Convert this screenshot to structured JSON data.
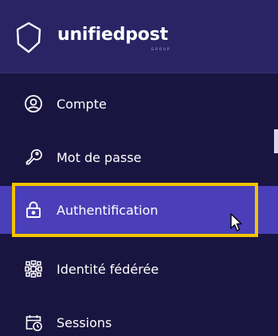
{
  "brand": {
    "name": "unifiedpost",
    "sub": "GROUP"
  },
  "menu": {
    "items": [
      {
        "label": "Compte",
        "icon": "user-circle-icon"
      },
      {
        "label": "Mot de passe",
        "icon": "key-icon"
      },
      {
        "label": "Authentification",
        "icon": "lock-icon",
        "active": true
      },
      {
        "label": "Identité fédérée",
        "icon": "network-icon"
      },
      {
        "label": "Sessions",
        "icon": "calendar-clock-icon"
      }
    ]
  },
  "colors": {
    "background": "#1a1540",
    "header": "#2a2465",
    "active": "#4a3fb8",
    "highlight": "#f5c400"
  }
}
